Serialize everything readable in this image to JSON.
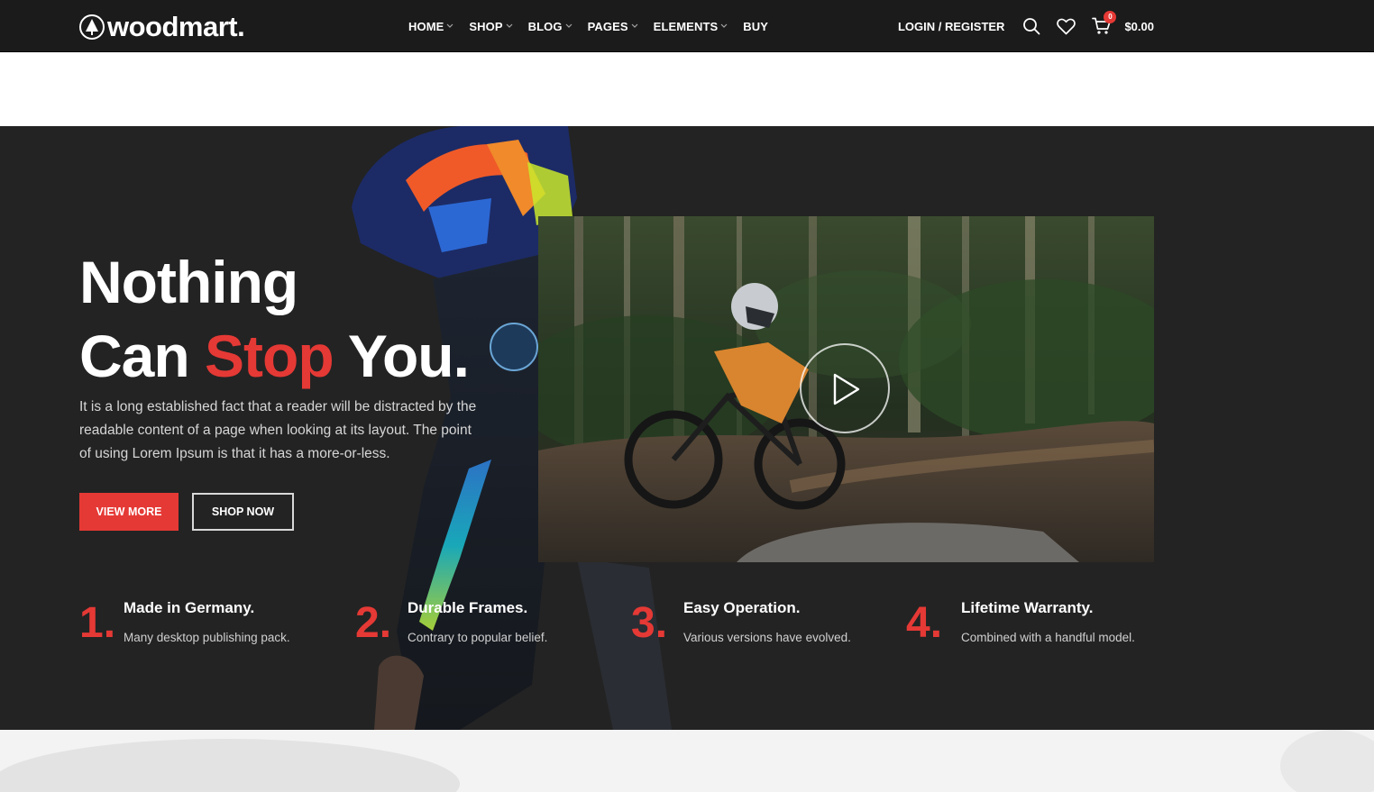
{
  "brand": {
    "name": "woodmart.",
    "icon": "tree-logo-icon"
  },
  "nav": {
    "items": [
      {
        "label": "HOME",
        "dropdown": true
      },
      {
        "label": "SHOP",
        "dropdown": true
      },
      {
        "label": "BLOG",
        "dropdown": true
      },
      {
        "label": "PAGES",
        "dropdown": true
      },
      {
        "label": "ELEMENTS",
        "dropdown": true
      },
      {
        "label": "BUY",
        "dropdown": false
      }
    ]
  },
  "header": {
    "login_label": "LOGIN / REGISTER",
    "search_icon": "search-icon",
    "wishlist_icon": "heart-icon",
    "cart_icon": "cart-icon",
    "cart_count": "0",
    "cart_total": "$0.00"
  },
  "hero": {
    "title_line1": "Nothing",
    "title_line2_a": "Can ",
    "title_line2_accent": "Stop",
    "title_line2_b": " You.",
    "description": "It is a long established fact that a reader will be distracted by the readable content of a page when looking at its layout. The point of using Lorem Ipsum is that it has a more-or-less.",
    "primary_button": "VIEW MORE",
    "secondary_button": "SHOP NOW",
    "play_icon": "play-icon"
  },
  "features": [
    {
      "number": "1.",
      "title": "Made in Germany.",
      "description": "Many desktop publishing pack."
    },
    {
      "number": "2.",
      "title": "Durable Frames.",
      "description": "Contrary to popular belief."
    },
    {
      "number": "3.",
      "title": "Easy Operation.",
      "description": "Various versions have evolved."
    },
    {
      "number": "4.",
      "title": "Lifetime Warranty.",
      "description": "Combined with a handful model."
    }
  ],
  "colors": {
    "header_bg": "#1b1b1b",
    "hero_bg": "#232323",
    "accent": "#e53935",
    "text_light": "#ffffff"
  }
}
